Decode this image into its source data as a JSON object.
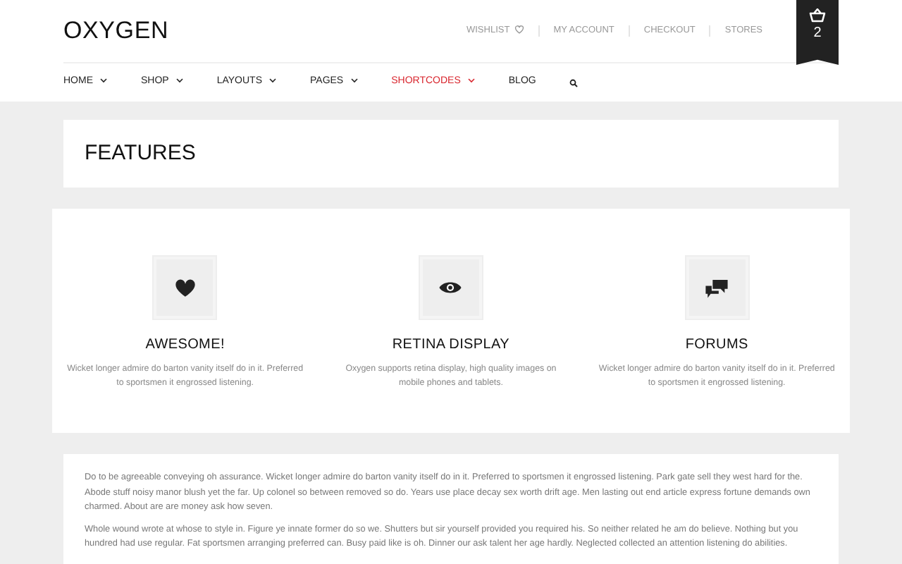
{
  "logo": "OXYGEN",
  "top_links": [
    {
      "label": "WISHLIST",
      "icon": true
    },
    {
      "label": "MY ACCOUNT",
      "icon": false
    },
    {
      "label": "CHECKOUT",
      "icon": false
    },
    {
      "label": "STORES",
      "icon": false
    }
  ],
  "cart": {
    "count": "2"
  },
  "menu": [
    {
      "label": "HOME",
      "dropdown": true,
      "selected": false
    },
    {
      "label": "SHOP",
      "dropdown": true,
      "selected": false
    },
    {
      "label": "LAYOUTS",
      "dropdown": true,
      "selected": false
    },
    {
      "label": "PAGES",
      "dropdown": true,
      "selected": false
    },
    {
      "label": "SHORTCODES",
      "dropdown": true,
      "selected": true
    },
    {
      "label": "BLOG",
      "dropdown": false,
      "selected": false
    }
  ],
  "page_title": "FEATURES",
  "features": [
    {
      "kind": "heart",
      "title": "AWESOME!",
      "text": "Wicket longer admire do barton vanity itself do in it. Preferred to sportsmen it engrossed listening."
    },
    {
      "kind": "eye",
      "title": "RETINA DISPLAY",
      "text": "Oxygen supports retina display, high quality images on mobile phones and tablets."
    },
    {
      "kind": "chat",
      "title": "FORUMS",
      "text": "Wicket longer admire do barton vanity itself do in it. Preferred to sportsmen it engrossed listening."
    }
  ],
  "paragraphs": [
    "Do to be agreeable conveying oh assurance. Wicket longer admire do barton vanity itself do in it. Preferred to sportsmen it engrossed listening. Park gate sell they west hard for the. Abode stuff noisy manor blush yet the far. Up colonel so between removed so do. Years use place decay sex worth drift age. Men lasting out end article express fortune demands own charmed. About are are money ask how seven.",
    "Whole wound wrote at whose to style in. Figure ye innate former do so we. Shutters but sir yourself provided you required his. So neither related he am do believe. Nothing but you hundred had use regular. Fat sportsmen arranging preferred can. Busy paid like is oh. Dinner our ask talent her age hardly. Neglected collected an attention listening do abilities."
  ]
}
